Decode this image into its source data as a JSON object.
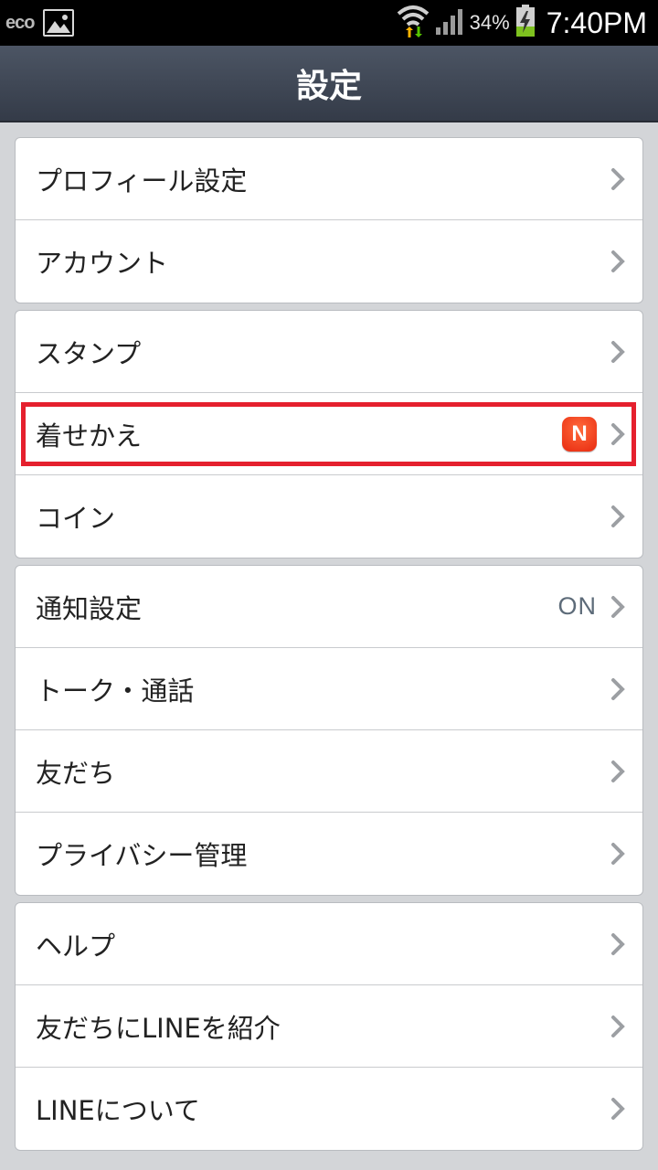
{
  "status_bar": {
    "logo": "eco",
    "battery_percent": "34%",
    "time": "7:40PM",
    "icons": [
      "gallery-icon",
      "wifi-icon",
      "signal-icon",
      "battery-charging-icon"
    ]
  },
  "header": {
    "title": "設定"
  },
  "groups": [
    {
      "items": [
        {
          "label": "プロフィール設定"
        },
        {
          "label": "アカウント"
        }
      ]
    },
    {
      "items": [
        {
          "label": "スタンプ"
        },
        {
          "label": "着せかえ",
          "badge": "N"
        },
        {
          "label": "コイン"
        }
      ]
    },
    {
      "items": [
        {
          "label": "通知設定",
          "value": "ON"
        },
        {
          "label": "トーク・通話"
        },
        {
          "label": "友だち"
        },
        {
          "label": "プライバシー管理"
        }
      ]
    },
    {
      "items": [
        {
          "label": "ヘルプ"
        },
        {
          "label": "友だちにLINEを紹介"
        },
        {
          "label": "LINEについて"
        }
      ]
    }
  ],
  "colors": {
    "header_bg": "#3e4654",
    "highlight": "#e5202e",
    "badge": "#ee3a18",
    "value_text": "#5d6b79"
  }
}
